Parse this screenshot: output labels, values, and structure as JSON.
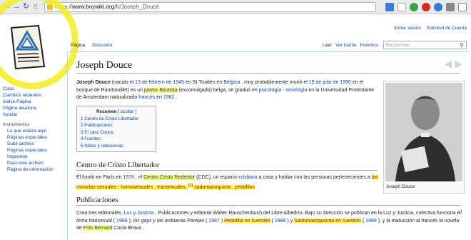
{
  "browser": {
    "url_prefix": "https://",
    "url_host": "www.boywiki.org",
    "url_path": "/fr/Joseph_Doucé"
  },
  "personal_tools": [
    "Iniciar sesión",
    "Solicitud de Cuenta"
  ],
  "tabs_left": [
    "Página",
    "Discusión"
  ],
  "tabs_right": [
    "Leer",
    "Ver fuente",
    "Histórico"
  ],
  "search": {
    "placeholder": "Rechercher"
  },
  "sidebar": {
    "nav": [
      "Casa",
      "Cambios recientes",
      "Índice Página",
      "Página aleatoria",
      "Ayudar"
    ],
    "tools_heading": "Instrumentos",
    "tools": [
      "Lo que enlaza aquí",
      "Páginas especiales",
      "Subir archivo",
      "Páginas especiales",
      "Impresión",
      "Para este archivo",
      "Página de información"
    ]
  },
  "article": {
    "title": "Joseph Douce",
    "intro_name": "Joseph Douce",
    "intro_1": " (nacido el ",
    "intro_date1": "13 de febrero de 1945",
    "intro_2": " en St Truiden en ",
    "intro_belgica": "Bélgica",
    "intro_3": " , muy probablemente murió el ",
    "intro_date2": "19 de julio de 1990",
    "intro_4": " en el bosque de Rambouillet) es un ",
    "intro_pastor": "pastor Bautista",
    "intro_5": " (excomulgado) belga, se graduó en ",
    "intro_psico": "psicología",
    "intro_6": " - ",
    "intro_sexo": "sexología",
    "intro_7": " en la Universidad Protestante de Amsterdam naturalizado ",
    "intro_frances": "francés",
    "intro_8": " en ",
    "intro_year": "1982",
    "intro_9": " .",
    "toc_title": "Resumen",
    "toc_hide": "[ ocultar ]",
    "toc_items": [
      "1 Centro de Cristo Libertador",
      "2 Publicaciones",
      "3 El caso Douce",
      "4 Fuentes",
      "5 Notas y referencias"
    ],
    "caption": "Joseph Douce",
    "sec1_title": "Centro de Cristo Libertador",
    "sec1_a": "Él fundó en París en ",
    "sec1_year": "1976",
    "sec1_b": " , el ",
    "sec1_ccr": "Centro Cristo Redentor",
    "sec1_c": " (CDC), un espacio ",
    "sec1_crist": "cristiana",
    "sec1_d": " a casa y hablar con las personas pertenecientes a ",
    "sec1_min": "las minorías sexuales : homosexuales , transexuales, ",
    "sec1_ref": "[1]",
    "sec1_sado": " sadomasoquista , pedófilos",
    "sec1_e": " .",
    "sec2_title": "Publicaciones",
    "sec2_a": "Crea tres editoriales, ",
    "sec2_luz": "Luz y Justicia",
    "sec2_b": " , Publicaciones y editorial Walter Rauschenbush del Libre Albedrío. Bajo su dirección se publican en la Luz y Justicia, colectiva funciona ",
    "sec2_t1": "El tema transexual",
    "sec2_c": " ( ",
    "sec2_y1": "1986",
    "sec2_d": " ), ",
    "sec2_t2": "los gays y las lesbianas Parejas",
    "sec2_e": " ( ",
    "sec2_y2": "1987",
    "sec2_f": " ) ",
    "sec2_t3": "Pedofilia en cuestión",
    "sec2_g": " ( ",
    "sec2_y3": "1988",
    "sec2_h": " ) y ",
    "sec2_t4": "Sadomasoquismo en cuestión",
    "sec2_i": " ( ",
    "sec2_y4": "1989",
    "sec2_j": " ), y la traducción al francés la novela de ",
    "sec2_frits": "Frits Bernard",
    "sec2_k": " ",
    "sec2_costa": "Costa Brava",
    "sec2_l": " ."
  }
}
